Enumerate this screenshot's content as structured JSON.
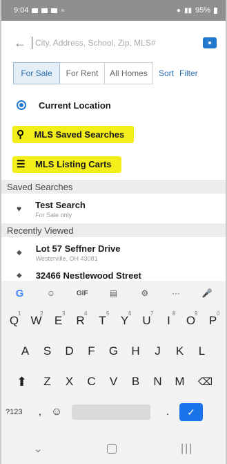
{
  "status": {
    "time": "9:04",
    "battery": "95%"
  },
  "search": {
    "placeholder": "City, Address, School, Zip, MLS#"
  },
  "tabs": [
    {
      "label": "For Sale"
    },
    {
      "label": "For Rent"
    },
    {
      "label": "All Homes"
    }
  ],
  "links": {
    "sort": "Sort",
    "filter": "Filter"
  },
  "menu": {
    "current_location": "Current Location",
    "saved_searches": "MLS Saved Searches",
    "listing_carts": "MLS Listing Carts"
  },
  "sections": {
    "saved": "Saved Searches",
    "recent": "Recently Viewed"
  },
  "saved_items": [
    {
      "title": "Test Search",
      "subtitle": "For Sale only"
    }
  ],
  "recent_items": [
    {
      "title": "Lot 57 Seffner Drive",
      "subtitle": "Westerville, OH 43081"
    },
    {
      "title": "32466 Nestlewood Street",
      "subtitle": ""
    }
  ],
  "keyboard": {
    "toolbar": [
      "G",
      "☺",
      "GIF",
      "▤",
      "⚙",
      "···",
      "🎤"
    ],
    "row1": [
      {
        "k": "Q",
        "n": "1"
      },
      {
        "k": "W",
        "n": "2"
      },
      {
        "k": "E",
        "n": "3"
      },
      {
        "k": "R",
        "n": "4"
      },
      {
        "k": "T",
        "n": "5"
      },
      {
        "k": "Y",
        "n": "6"
      },
      {
        "k": "U",
        "n": "7"
      },
      {
        "k": "I",
        "n": "8"
      },
      {
        "k": "O",
        "n": "9"
      },
      {
        "k": "P",
        "n": "0"
      }
    ],
    "row2": [
      "A",
      "S",
      "D",
      "F",
      "G",
      "H",
      "J",
      "K",
      "L"
    ],
    "row3": [
      "Z",
      "X",
      "C",
      "V",
      "B",
      "N",
      "M"
    ],
    "bottom": {
      "sym": "?123",
      "comma": ",",
      "period": "."
    }
  }
}
